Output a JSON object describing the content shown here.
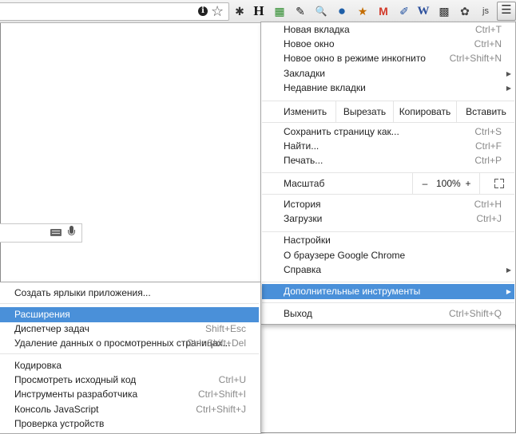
{
  "toolbar": {
    "extensions": [
      {
        "icon": "bug-icon",
        "glyph": "✱"
      },
      {
        "icon": "h-extension-icon",
        "glyph": "H"
      },
      {
        "icon": "colorful-extension-icon",
        "glyph": "▦"
      },
      {
        "icon": "feather-icon",
        "glyph": "✎"
      },
      {
        "icon": "magnifier-icon",
        "glyph": "🔍"
      },
      {
        "icon": "globe-icon",
        "glyph": "●"
      },
      {
        "icon": "stk-icon",
        "glyph": "★"
      },
      {
        "icon": "gmail-icon",
        "glyph": "M"
      },
      {
        "icon": "edit-extension-icon",
        "glyph": "✐"
      },
      {
        "icon": "w-extension-icon",
        "glyph": "W"
      },
      {
        "icon": "qr-code-icon",
        "glyph": "▩"
      },
      {
        "icon": "evernote-icon",
        "glyph": "✿"
      },
      {
        "icon": "js-extension-icon",
        "glyph": "js"
      }
    ],
    "menu_glyph": "☰"
  },
  "menu": {
    "new_tab": {
      "label": "Новая вкладка",
      "shortcut": "Ctrl+T"
    },
    "new_window": {
      "label": "Новое окно",
      "shortcut": "Ctrl+N"
    },
    "incognito": {
      "label": "Новое окно в режиме инкогнито",
      "shortcut": "Ctrl+Shift+N"
    },
    "bookmarks": {
      "label": "Закладки"
    },
    "recent_tabs": {
      "label": "Недавние вкладки"
    },
    "edit": {
      "label": "Изменить",
      "cut": "Вырезать",
      "copy": "Копировать",
      "paste": "Вставить"
    },
    "save_page": {
      "label": "Сохранить страницу как...",
      "shortcut": "Ctrl+S"
    },
    "find": {
      "label": "Найти...",
      "shortcut": "Ctrl+F"
    },
    "print": {
      "label": "Печать...",
      "shortcut": "Ctrl+P"
    },
    "zoom": {
      "label": "Масштаб",
      "minus": "–",
      "value": "100%",
      "plus": "+"
    },
    "history": {
      "label": "История",
      "shortcut": "Ctrl+H"
    },
    "downloads": {
      "label": "Загрузки",
      "shortcut": "Ctrl+J"
    },
    "settings": {
      "label": "Настройки"
    },
    "about": {
      "label": "О браузере Google Chrome"
    },
    "help": {
      "label": "Справка"
    },
    "more_tools": {
      "label": "Дополнительные инструменты"
    },
    "exit": {
      "label": "Выход",
      "shortcut": "Ctrl+Shift+Q"
    }
  },
  "submenu": {
    "create_shortcuts": {
      "label": "Создать ярлыки приложения..."
    },
    "extensions": {
      "label": "Расширения"
    },
    "task_manager": {
      "label": "Диспетчер задач",
      "shortcut": "Shift+Esc"
    },
    "clear_data": {
      "label": "Удаление данных о просмотренных страницах...",
      "shortcut": "Ctrl+Shift+Del"
    },
    "encoding": {
      "label": "Кодировка"
    },
    "view_source": {
      "label": "Просмотреть исходный код",
      "shortcut": "Ctrl+U"
    },
    "dev_tools": {
      "label": "Инструменты разработчика",
      "shortcut": "Ctrl+Shift+I"
    },
    "js_console": {
      "label": "Консоль JavaScript",
      "shortcut": "Ctrl+Shift+J"
    },
    "inspect_devices": {
      "label": "Проверка устройств"
    }
  },
  "colors": {
    "highlight": "#4a90d9"
  }
}
